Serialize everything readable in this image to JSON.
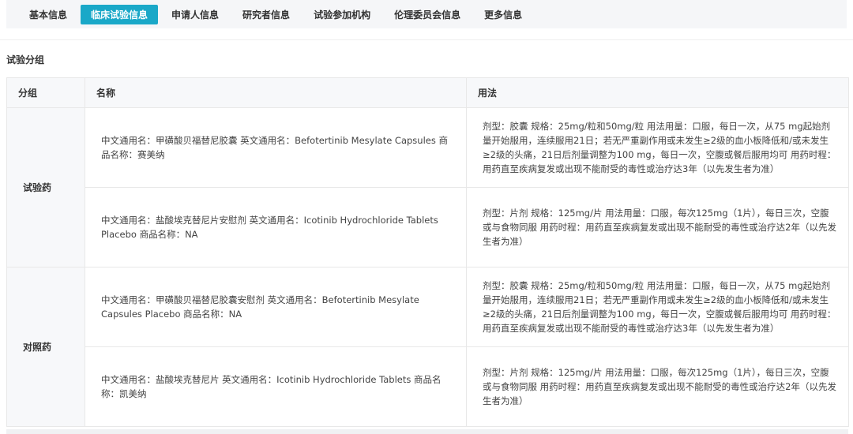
{
  "tabs": [
    {
      "label": "基本信息"
    },
    {
      "label": "临床试验信息"
    },
    {
      "label": "申请人信息"
    },
    {
      "label": "研究者信息"
    },
    {
      "label": "试验参加机构"
    },
    {
      "label": "伦理委员会信息"
    },
    {
      "label": "更多信息"
    }
  ],
  "active_tab": "临床试验信息",
  "section": {
    "title": "试验分组"
  },
  "table": {
    "headers": {
      "group": "分组",
      "name": "名称",
      "usage": "用法"
    },
    "groups": [
      {
        "label": "试验药",
        "rows": [
          {
            "name": "中文通用名：甲磺酸贝福替尼胶囊 英文通用名：Befotertinib Mesylate Capsules 商品名称：赛美纳",
            "usage": "剂型：胶囊 规格：25mg/粒和50mg/粒 用法用量：口服，每日一次，从75 mg起始剂量开始服用，连续服用21日；若无严重副作用或未发生≥2级的血小板降低和/或未发生≥2级的头痛，21日后剂量调整为100 mg，每日一次，空腹或餐后服用均可 用药时程：用药直至疾病复发或出现不能耐受的毒性或治疗达3年（以先发生者为准）"
          },
          {
            "name": "中文通用名：盐酸埃克替尼片安慰剂 英文通用名：Icotinib Hydrochloride Tablets Placebo 商品名称：NA",
            "usage": "剂型：片剂 规格：125mg/片 用法用量：口服，每次125mg（1片），每日三次，空腹或与食物同服 用药时程：用药直至疾病复发或出现不能耐受的毒性或治疗达2年（以先发生者为准）"
          }
        ]
      },
      {
        "label": "对照药",
        "rows": [
          {
            "name": "中文通用名：甲磺酸贝福替尼胶囊安慰剂 英文通用名：Befotertinib Mesylate Capsules Placebo 商品名称：NA",
            "usage": "剂型：胶囊 规格：25mg/粒和50mg/粒 用法用量：口服，每日一次，从75 mg起始剂量开始服用，连续服用21日；若无严重副作用或未发生≥2级的血小板降低和/或未发生≥2级的头痛，21日后剂量调整为100 mg，每日一次，空腹或餐后服用均可 用药时程：用药直至疾病复发或出现不能耐受的毒性或治疗达3年（以先发生者为准）"
          },
          {
            "name": "中文通用名：盐酸埃克替尼片 英文通用名：Icotinib Hydrochloride Tablets 商品名称：凯美纳",
            "usage": "剂型：片剂 规格：125mg/片 用法用量：口服，每次125mg（1片），每日三次，空腹或与食物同服 用药时程：用药直至疾病复发或出现不能耐受的毒性或治疗达2年（以先发生者为准）"
          }
        ]
      }
    ]
  },
  "colors": {
    "accent": "#1aa8c8",
    "header_bg": "#f7f8fa",
    "border": "#e8e8e8"
  }
}
